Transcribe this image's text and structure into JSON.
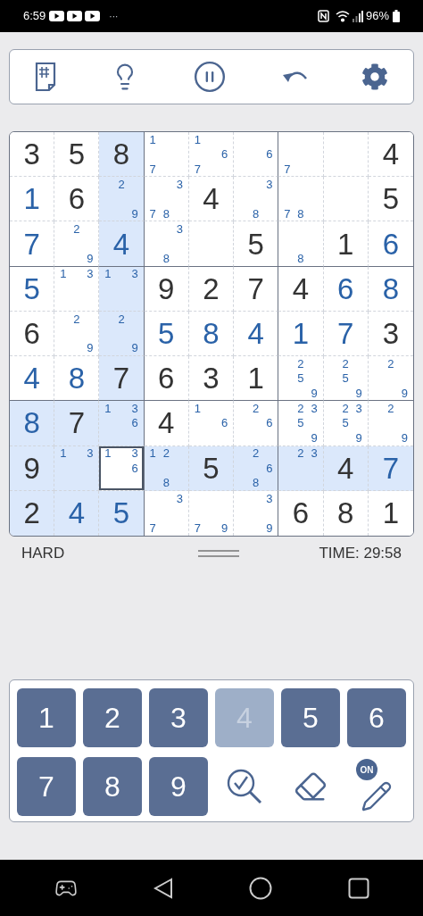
{
  "status_bar": {
    "time": "6:59",
    "more": "···",
    "battery": "96%"
  },
  "grid": {
    "rows": [
      [
        {
          "kind": "given",
          "value": "3",
          "selected": false
        },
        {
          "kind": "given",
          "value": "5",
          "selected": false
        },
        {
          "kind": "given",
          "value": "8",
          "selected": false
        },
        {
          "kind": "notes",
          "notes": [
            "1",
            "7"
          ],
          "selected": false
        },
        {
          "kind": "notes",
          "notes": [
            "1",
            "6",
            "7"
          ],
          "selected": false
        },
        {
          "kind": "notes",
          "notes": [
            "6"
          ],
          "selected": false
        },
        {
          "kind": "notes",
          "notes": [
            "7"
          ],
          "selected": false
        },
        {
          "kind": "empty",
          "selected": false
        },
        {
          "kind": "given",
          "value": "4",
          "selected": false
        }
      ],
      [
        {
          "kind": "entry",
          "value": "1",
          "selected": false
        },
        {
          "kind": "given",
          "value": "6",
          "selected": false
        },
        {
          "kind": "notes",
          "notes": [
            "2",
            "9"
          ],
          "selected": false
        },
        {
          "kind": "notes",
          "notes": [
            "3",
            "7",
            "8"
          ],
          "selected": false
        },
        {
          "kind": "given",
          "value": "4",
          "selected": false
        },
        {
          "kind": "notes",
          "notes": [
            "3",
            "8"
          ],
          "selected": false
        },
        {
          "kind": "notes",
          "notes": [
            "7",
            "8"
          ],
          "selected": false
        },
        {
          "kind": "empty",
          "selected": false
        },
        {
          "kind": "given",
          "value": "5",
          "selected": false
        }
      ],
      [
        {
          "kind": "entry",
          "value": "7",
          "selected": false
        },
        {
          "kind": "notes",
          "notes": [
            "2",
            "9"
          ],
          "selected": false
        },
        {
          "kind": "entry",
          "value": "4",
          "selected": false
        },
        {
          "kind": "notes",
          "notes": [
            "3",
            "8"
          ],
          "selected": false
        },
        {
          "kind": "empty",
          "selected": false
        },
        {
          "kind": "given",
          "value": "5",
          "selected": false
        },
        {
          "kind": "notes",
          "notes": [
            "8"
          ],
          "selected": false
        },
        {
          "kind": "given",
          "value": "1",
          "selected": false
        },
        {
          "kind": "entry",
          "value": "6",
          "selected": false
        }
      ],
      [
        {
          "kind": "entry",
          "value": "5",
          "selected": false
        },
        {
          "kind": "notes",
          "notes": [
            "1",
            "3"
          ],
          "selected": false
        },
        {
          "kind": "notes",
          "notes": [
            "1",
            "3"
          ],
          "selected": false
        },
        {
          "kind": "given",
          "value": "9",
          "selected": false
        },
        {
          "kind": "given",
          "value": "2",
          "selected": false
        },
        {
          "kind": "given",
          "value": "7",
          "selected": false
        },
        {
          "kind": "given",
          "value": "4",
          "selected": false
        },
        {
          "kind": "entry",
          "value": "6",
          "selected": false
        },
        {
          "kind": "entry",
          "value": "8",
          "selected": false
        }
      ],
      [
        {
          "kind": "given",
          "value": "6",
          "selected": false
        },
        {
          "kind": "notes",
          "notes": [
            "2",
            "9"
          ],
          "selected": false
        },
        {
          "kind": "notes",
          "notes": [
            "2",
            "9"
          ],
          "selected": false
        },
        {
          "kind": "entry",
          "value": "5",
          "selected": false
        },
        {
          "kind": "entry",
          "value": "8",
          "selected": false
        },
        {
          "kind": "entry",
          "value": "4",
          "selected": false
        },
        {
          "kind": "entry",
          "value": "1",
          "selected": false
        },
        {
          "kind": "entry",
          "value": "7",
          "selected": false
        },
        {
          "kind": "given",
          "value": "3",
          "selected": false
        }
      ],
      [
        {
          "kind": "entry",
          "value": "4",
          "selected": false
        },
        {
          "kind": "entry",
          "value": "8",
          "selected": false
        },
        {
          "kind": "given",
          "value": "7",
          "selected": false
        },
        {
          "kind": "given",
          "value": "6",
          "selected": false
        },
        {
          "kind": "given",
          "value": "3",
          "selected": false
        },
        {
          "kind": "given",
          "value": "1",
          "selected": false
        },
        {
          "kind": "notes",
          "notes": [
            "2",
            "5",
            "9"
          ],
          "selected": false
        },
        {
          "kind": "notes",
          "notes": [
            "2",
            "5",
            "9"
          ],
          "selected": false
        },
        {
          "kind": "notes",
          "notes": [
            "2",
            "9"
          ],
          "selected": false
        }
      ],
      [
        {
          "kind": "entry",
          "value": "8",
          "selected": false
        },
        {
          "kind": "given",
          "value": "7",
          "selected": false
        },
        {
          "kind": "notes",
          "notes": [
            "1",
            "3",
            "6"
          ],
          "selected": false
        },
        {
          "kind": "given",
          "value": "4",
          "selected": false
        },
        {
          "kind": "notes",
          "notes": [
            "1",
            "6"
          ],
          "selected": false
        },
        {
          "kind": "notes",
          "notes": [
            "2",
            "6"
          ],
          "selected": false
        },
        {
          "kind": "notes",
          "notes": [
            "2",
            "3",
            "5",
            "9"
          ],
          "selected": false
        },
        {
          "kind": "notes",
          "notes": [
            "2",
            "3",
            "5",
            "9"
          ],
          "selected": false
        },
        {
          "kind": "notes",
          "notes": [
            "2",
            "9"
          ],
          "selected": false
        }
      ],
      [
        {
          "kind": "given",
          "value": "9",
          "selected": false
        },
        {
          "kind": "notes",
          "notes": [
            "1",
            "3"
          ],
          "selected": false
        },
        {
          "kind": "notes",
          "notes": [
            "1",
            "3",
            "6"
          ],
          "selected": true
        },
        {
          "kind": "notes",
          "notes": [
            "1",
            "2",
            "8"
          ],
          "selected": false
        },
        {
          "kind": "given",
          "value": "5",
          "selected": false
        },
        {
          "kind": "notes",
          "notes": [
            "2",
            "6",
            "8"
          ],
          "selected": false
        },
        {
          "kind": "notes",
          "notes": [
            "2",
            "3"
          ],
          "selected": false
        },
        {
          "kind": "given",
          "value": "4",
          "selected": false
        },
        {
          "kind": "entry",
          "value": "7",
          "selected": false
        }
      ],
      [
        {
          "kind": "given",
          "value": "2",
          "selected": false
        },
        {
          "kind": "entry",
          "value": "4",
          "selected": false
        },
        {
          "kind": "entry",
          "value": "5",
          "selected": false
        },
        {
          "kind": "notes",
          "notes": [
            "3",
            "7"
          ],
          "selected": false
        },
        {
          "kind": "notes",
          "notes": [
            "7",
            "9"
          ],
          "selected": false
        },
        {
          "kind": "notes",
          "notes": [
            "3",
            "9"
          ],
          "selected": false
        },
        {
          "kind": "given",
          "value": "6",
          "selected": false
        },
        {
          "kind": "given",
          "value": "8",
          "selected": false
        },
        {
          "kind": "given",
          "value": "1",
          "selected": false
        }
      ]
    ]
  },
  "footer": {
    "difficulty": "HARD",
    "timer": "TIME: 29:58"
  },
  "keypad": {
    "keys": [
      {
        "label": "1",
        "disabled": false
      },
      {
        "label": "2",
        "disabled": false
      },
      {
        "label": "3",
        "disabled": false
      },
      {
        "label": "4",
        "disabled": true
      },
      {
        "label": "5",
        "disabled": false
      },
      {
        "label": "6",
        "disabled": false
      },
      {
        "label": "7",
        "disabled": false
      },
      {
        "label": "8",
        "disabled": false
      },
      {
        "label": "9",
        "disabled": false
      }
    ],
    "pencil": {
      "badge": "ON",
      "on": true
    }
  }
}
